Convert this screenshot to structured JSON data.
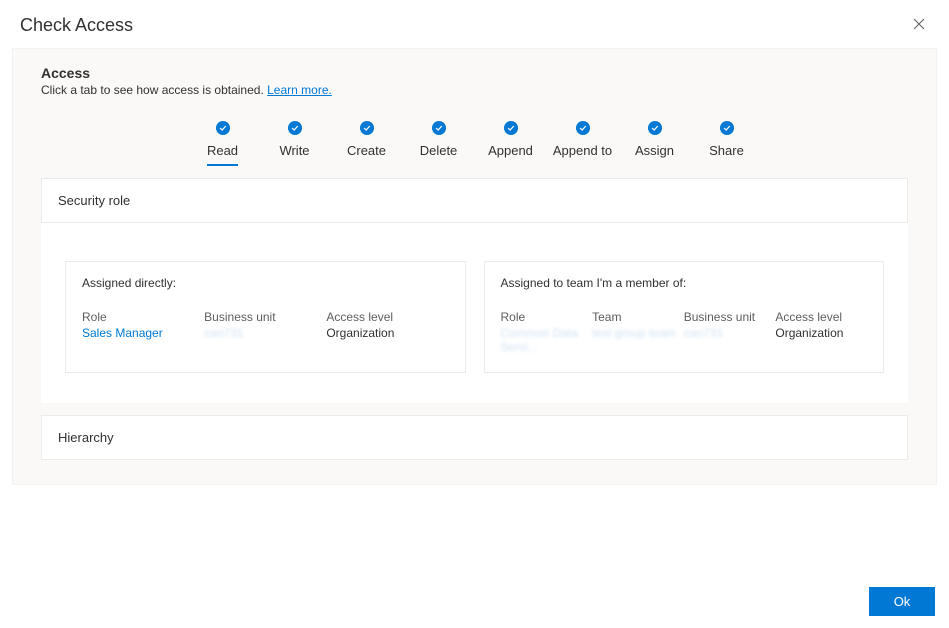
{
  "dialog": {
    "title": "Check Access"
  },
  "access": {
    "heading": "Access",
    "description": "Click a tab to see how access is obtained. ",
    "learn_more": "Learn more."
  },
  "tabs": {
    "read": "Read",
    "write": "Write",
    "create": "Create",
    "delete": "Delete",
    "append": "Append",
    "append_to": "Append to",
    "assign": "Assign",
    "share": "Share"
  },
  "sections": {
    "security_role": "Security role",
    "hierarchy": "Hierarchy"
  },
  "assigned_directly": {
    "title": "Assigned directly:",
    "role_label": "Role",
    "role_value": "Sales Manager",
    "bu_label": "Business unit",
    "bu_value": "can731",
    "access_label": "Access level",
    "access_value": "Organization"
  },
  "assigned_team": {
    "title": "Assigned to team I'm a member of:",
    "role_label": "Role",
    "role_value": "Common Data Servi...",
    "team_label": "Team",
    "team_value": "test group team",
    "bu_label": "Business unit",
    "bu_value": "can731",
    "access_label": "Access level",
    "access_value": "Organization"
  },
  "footer": {
    "ok": "Ok"
  }
}
